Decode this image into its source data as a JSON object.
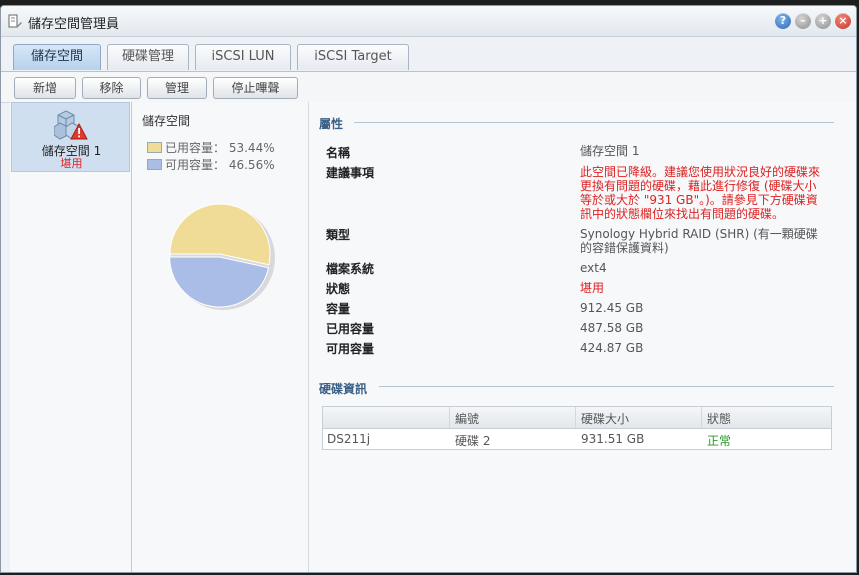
{
  "window": {
    "title": "儲存空間管理員"
  },
  "tabs": [
    {
      "label": "儲存空間",
      "active": true
    },
    {
      "label": "硬碟管理",
      "active": false
    },
    {
      "label": "iSCSI LUN",
      "active": false
    },
    {
      "label": "iSCSI Target",
      "active": false
    }
  ],
  "toolbar": {
    "create": "新增",
    "remove": "移除",
    "manage": "管理",
    "stop_beep": "停止嗶聲"
  },
  "volume_list": [
    {
      "name": "儲存空間 1",
      "status": "堪用",
      "icon": "warning-volume-icon"
    }
  ],
  "usage": {
    "title": "儲存空間",
    "used_label": "已用容量：",
    "used_pct": "53.44%",
    "free_label": "可用容量：",
    "free_pct": "46.56%",
    "colors": {
      "used": "#f0dc96",
      "free": "#a9bde6"
    }
  },
  "chart_data": {
    "type": "pie",
    "labels": [
      "已用容量",
      "可用容量"
    ],
    "values": [
      53.44,
      46.56
    ],
    "title": "儲存空間"
  },
  "properties": {
    "heading": "屬性",
    "name_label": "名稱",
    "name_value": "儲存空間 1",
    "suggestion_label": "建議事項",
    "suggestion_value": "此空間已降級。建議您使用狀況良好的硬碟來更換有問題的硬碟，藉此進行修復 (硬碟大小等於或大於 \"931 GB\"。)。請參見下方硬碟資訊中的狀態欄位來找出有問題的硬碟。",
    "type_label": "類型",
    "type_value": "Synology Hybrid RAID (SHR) (有一顆硬碟的容錯保護資料)",
    "fs_label": "檔案系統",
    "fs_value": "ext4",
    "status_label": "狀態",
    "status_value": "堪用",
    "capacity_label": "容量",
    "capacity_value": "912.45 GB",
    "used_label": "已用容量",
    "used_value": "487.58 GB",
    "free_label": "可用容量",
    "free_value": "424.87 GB"
  },
  "disk_info": {
    "heading": "硬碟資訊",
    "columns": [
      "",
      "編號",
      "硬碟大小",
      "狀態"
    ],
    "rows": [
      {
        "device": "DS211j",
        "number": "硬碟 2",
        "size": "931.51 GB",
        "status": "正常"
      }
    ]
  }
}
